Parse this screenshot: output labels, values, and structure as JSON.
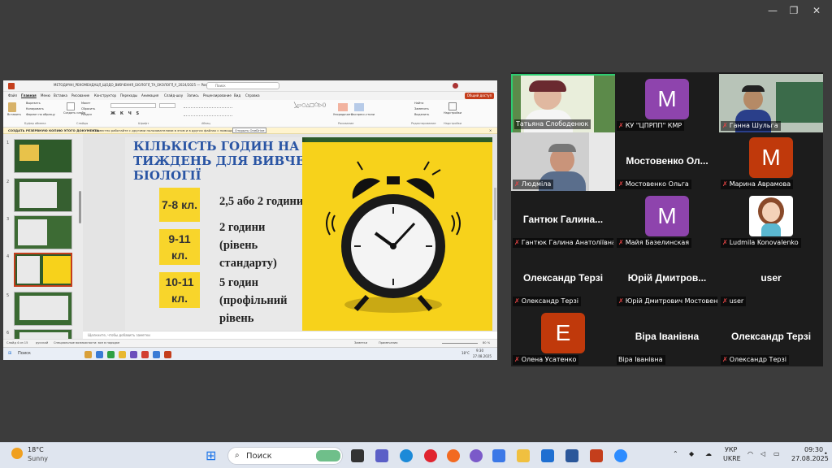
{
  "window_controls": {
    "minimize": "—",
    "restore": "❐",
    "close": "✕"
  },
  "powerpoint": {
    "title": "МЕТОДИЧНІ_РЕКОМЕНДАЦІЇ_ЩОДО_ВИВЧЕННЯ_БІОЛОГІЇ_ТА_ЕКОЛОГІЇ_У_2024/2025 — PowerPoint",
    "search": "Поиск",
    "share": "Общий доступ",
    "menu": [
      "Файл",
      "Главная",
      "Меню",
      "Вставка",
      "Рисование",
      "Конструктор",
      "Переходы",
      "Анимация",
      "Слайд-шоу",
      "Запись",
      "Рецензирование",
      "Вид",
      "Справка"
    ],
    "ribbon": {
      "clipboard": [
        "Вырезать",
        "Копировать",
        "Формат по образцу"
      ],
      "paste": "Вставить",
      "slides": [
        "Макет",
        "Сбросить",
        "Раздел"
      ],
      "new_slide": "Создать слайд",
      "arrange": "Упорядочить",
      "styles": "Экспресс-стили",
      "find": [
        "Найти",
        "Заменить",
        "Выделить"
      ],
      "addins": "Надстройки",
      "groups": [
        "Буфер обмена",
        "Слайды",
        "Шрифт",
        "Абзац",
        "Рисование",
        "Редактирование",
        "Надстройки"
      ]
    },
    "info_bar": {
      "title": "СОЗДАТЬ РЕЗЕРВНУЮ КОПИЮ ЭТОГО ДОКУМЕНТА",
      "text": "Совместно работайте с другими пользователями в этом и в других файлах с помощью OneDrive.",
      "button": "Открыть OneDrive"
    },
    "slide_numbers": [
      "1",
      "2",
      "3",
      "4",
      "5",
      "6"
    ],
    "notes": "Щелкните, чтобы добавить заметки",
    "status": {
      "slide": "Слайд 4 из 15",
      "language": "русский",
      "accessibility": "Специальные возможности: все в порядке",
      "notes": "Заметки",
      "comments": "Примечания",
      "zoom": "80 %"
    },
    "inner_taskbar": {
      "search": "Поиск",
      "time": "9:30",
      "date": "27.08.2025",
      "temp": "18°C"
    }
  },
  "slide": {
    "title_lines": [
      "КІЛЬКІСТЬ ГОДИН НА",
      "ТИЖДЕНЬ ДЛЯ ВИВЧЕННЯ",
      "БІОЛОГІЇ"
    ],
    "rows": [
      {
        "grade": "7-8 кл.",
        "hours": [
          "2,5 або 2 години"
        ]
      },
      {
        "grade": "9-11 кл.",
        "hours": [
          "2 години",
          "(рівень",
          "стандарту)"
        ]
      },
      {
        "grade": "10-11 кл.",
        "hours": [
          "5 годин",
          "(профільний",
          "рівень"
        ]
      }
    ]
  },
  "participants": [
    {
      "name": "Татьяна Слободенюк",
      "type": "video",
      "muted": false,
      "active": true
    },
    {
      "name": "КУ \"ЦПРПП\" КМР",
      "type": "avatar",
      "letter": "M",
      "color": "#8e44ad",
      "muted": true
    },
    {
      "name": "Ганна Шульга",
      "type": "video",
      "muted": true
    },
    {
      "name": "Людміла",
      "type": "video",
      "muted": true
    },
    {
      "name": "Мостовенко Ольга",
      "type": "name",
      "big": "Мостовенко  Ол...",
      "muted": true
    },
    {
      "name": "Марина Аврамова",
      "type": "avatar",
      "letter": "M",
      "color": "#c0390b",
      "muted": true
    },
    {
      "name": "Гантюк Галина Анатоліївна",
      "type": "name",
      "big": "Гантюк  Галина...",
      "muted": true
    },
    {
      "name": "Майя Базелинская",
      "type": "avatar",
      "letter": "M",
      "color": "#8e44ad",
      "muted": true
    },
    {
      "name": "Ludmila Konovalenko",
      "type": "cartoon",
      "muted": true
    },
    {
      "name": "Олександр Терзі",
      "type": "name",
      "big": "Олександр Терзі",
      "muted": true
    },
    {
      "name": "Юрій Дмитрович Мостовенко",
      "type": "name",
      "big": "Юрій  Дмитров...",
      "label": "Юрій Дмитрович Мостовен...",
      "muted": true
    },
    {
      "name": "user",
      "type": "name",
      "big": "user",
      "muted": true
    },
    {
      "name": "Олена Усатенко",
      "type": "avatar",
      "letter": "E",
      "color": "#c0390b",
      "muted": true
    },
    {
      "name": "Віра Іванівна",
      "type": "name",
      "big": "Віра Іванівна",
      "muted": false
    },
    {
      "name": "Олександр Терзі",
      "type": "name",
      "big": "Олександр Терзі",
      "muted": true
    }
  ],
  "taskbar": {
    "weather_temp": "18°C",
    "weather_desc": "Sunny",
    "search": "Поиск",
    "language_top": "УКР",
    "language_bottom": "UKRE",
    "time": "09:30",
    "date": "27.08.2025"
  }
}
